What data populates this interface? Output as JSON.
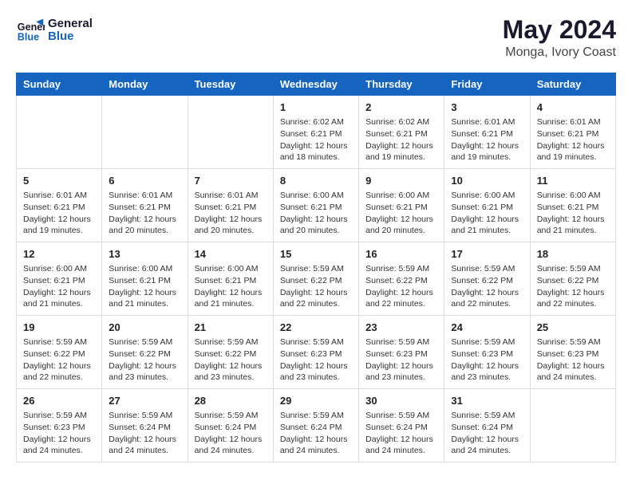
{
  "header": {
    "logo_line1": "General",
    "logo_line2": "Blue",
    "month_year": "May 2024",
    "location": "Monga, Ivory Coast"
  },
  "weekdays": [
    "Sunday",
    "Monday",
    "Tuesday",
    "Wednesday",
    "Thursday",
    "Friday",
    "Saturday"
  ],
  "weeks": [
    [
      {
        "day": "",
        "info": ""
      },
      {
        "day": "",
        "info": ""
      },
      {
        "day": "",
        "info": ""
      },
      {
        "day": "1",
        "info": "Sunrise: 6:02 AM\nSunset: 6:21 PM\nDaylight: 12 hours\nand 18 minutes."
      },
      {
        "day": "2",
        "info": "Sunrise: 6:02 AM\nSunset: 6:21 PM\nDaylight: 12 hours\nand 19 minutes."
      },
      {
        "day": "3",
        "info": "Sunrise: 6:01 AM\nSunset: 6:21 PM\nDaylight: 12 hours\nand 19 minutes."
      },
      {
        "day": "4",
        "info": "Sunrise: 6:01 AM\nSunset: 6:21 PM\nDaylight: 12 hours\nand 19 minutes."
      }
    ],
    [
      {
        "day": "5",
        "info": "Sunrise: 6:01 AM\nSunset: 6:21 PM\nDaylight: 12 hours\nand 19 minutes."
      },
      {
        "day": "6",
        "info": "Sunrise: 6:01 AM\nSunset: 6:21 PM\nDaylight: 12 hours\nand 20 minutes."
      },
      {
        "day": "7",
        "info": "Sunrise: 6:01 AM\nSunset: 6:21 PM\nDaylight: 12 hours\nand 20 minutes."
      },
      {
        "day": "8",
        "info": "Sunrise: 6:00 AM\nSunset: 6:21 PM\nDaylight: 12 hours\nand 20 minutes."
      },
      {
        "day": "9",
        "info": "Sunrise: 6:00 AM\nSunset: 6:21 PM\nDaylight: 12 hours\nand 20 minutes."
      },
      {
        "day": "10",
        "info": "Sunrise: 6:00 AM\nSunset: 6:21 PM\nDaylight: 12 hours\nand 21 minutes."
      },
      {
        "day": "11",
        "info": "Sunrise: 6:00 AM\nSunset: 6:21 PM\nDaylight: 12 hours\nand 21 minutes."
      }
    ],
    [
      {
        "day": "12",
        "info": "Sunrise: 6:00 AM\nSunset: 6:21 PM\nDaylight: 12 hours\nand 21 minutes."
      },
      {
        "day": "13",
        "info": "Sunrise: 6:00 AM\nSunset: 6:21 PM\nDaylight: 12 hours\nand 21 minutes."
      },
      {
        "day": "14",
        "info": "Sunrise: 6:00 AM\nSunset: 6:21 PM\nDaylight: 12 hours\nand 21 minutes."
      },
      {
        "day": "15",
        "info": "Sunrise: 5:59 AM\nSunset: 6:22 PM\nDaylight: 12 hours\nand 22 minutes."
      },
      {
        "day": "16",
        "info": "Sunrise: 5:59 AM\nSunset: 6:22 PM\nDaylight: 12 hours\nand 22 minutes."
      },
      {
        "day": "17",
        "info": "Sunrise: 5:59 AM\nSunset: 6:22 PM\nDaylight: 12 hours\nand 22 minutes."
      },
      {
        "day": "18",
        "info": "Sunrise: 5:59 AM\nSunset: 6:22 PM\nDaylight: 12 hours\nand 22 minutes."
      }
    ],
    [
      {
        "day": "19",
        "info": "Sunrise: 5:59 AM\nSunset: 6:22 PM\nDaylight: 12 hours\nand 22 minutes."
      },
      {
        "day": "20",
        "info": "Sunrise: 5:59 AM\nSunset: 6:22 PM\nDaylight: 12 hours\nand 23 minutes."
      },
      {
        "day": "21",
        "info": "Sunrise: 5:59 AM\nSunset: 6:22 PM\nDaylight: 12 hours\nand 23 minutes."
      },
      {
        "day": "22",
        "info": "Sunrise: 5:59 AM\nSunset: 6:23 PM\nDaylight: 12 hours\nand 23 minutes."
      },
      {
        "day": "23",
        "info": "Sunrise: 5:59 AM\nSunset: 6:23 PM\nDaylight: 12 hours\nand 23 minutes."
      },
      {
        "day": "24",
        "info": "Sunrise: 5:59 AM\nSunset: 6:23 PM\nDaylight: 12 hours\nand 23 minutes."
      },
      {
        "day": "25",
        "info": "Sunrise: 5:59 AM\nSunset: 6:23 PM\nDaylight: 12 hours\nand 24 minutes."
      }
    ],
    [
      {
        "day": "26",
        "info": "Sunrise: 5:59 AM\nSunset: 6:23 PM\nDaylight: 12 hours\nand 24 minutes."
      },
      {
        "day": "27",
        "info": "Sunrise: 5:59 AM\nSunset: 6:24 PM\nDaylight: 12 hours\nand 24 minutes."
      },
      {
        "day": "28",
        "info": "Sunrise: 5:59 AM\nSunset: 6:24 PM\nDaylight: 12 hours\nand 24 minutes."
      },
      {
        "day": "29",
        "info": "Sunrise: 5:59 AM\nSunset: 6:24 PM\nDaylight: 12 hours\nand 24 minutes."
      },
      {
        "day": "30",
        "info": "Sunrise: 5:59 AM\nSunset: 6:24 PM\nDaylight: 12 hours\nand 24 minutes."
      },
      {
        "day": "31",
        "info": "Sunrise: 5:59 AM\nSunset: 6:24 PM\nDaylight: 12 hours\nand 24 minutes."
      },
      {
        "day": "",
        "info": ""
      }
    ]
  ]
}
